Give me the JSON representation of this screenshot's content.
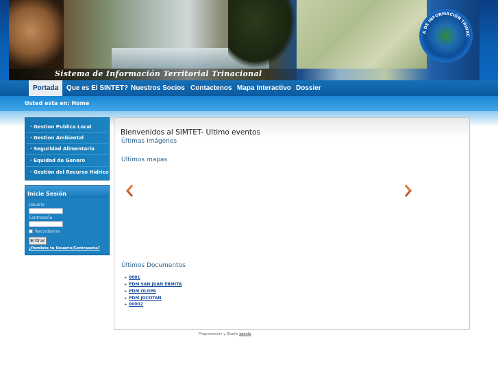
{
  "header": {
    "site_title": "Sistema de Información Territorial Trinacional",
    "logo_text": "SISTEMA DE INFORMACIÓN TRINACIONAL"
  },
  "nav": {
    "items": [
      "Portada",
      "Que es El SINTET?",
      "Nuestros Socios",
      "Contactenos",
      "Mapa Interactivo",
      "Dossier"
    ],
    "active": "Portada"
  },
  "breadcrumb": "Usted esta en: Home",
  "menu": {
    "items": [
      "Gestion Publica Local",
      "Gestion Ambiental",
      "Seguridad Alimentaria",
      "Equidad de Genero",
      "Gestión del Recurso Hídrico"
    ]
  },
  "login": {
    "title": "Inicie Sesión",
    "username_label": "Usuario",
    "password_label": "Contraseña",
    "remember_label": "Recordarme",
    "submit_label": "Entrar",
    "forgot_label": "¿Perdiste tu Usuario/Contraseña?"
  },
  "main": {
    "title": "Bienvenidos al SIMTET- Ultimo eventos",
    "images_heading": "Últimas Imágenes",
    "maps_heading": "Ultimos mapas",
    "docs_heading": "Últimos Documentos",
    "documents": [
      "0001",
      "PDM SAN JUAN ERMITA",
      "PDM OLOPA",
      "PDM JOCOTAN",
      "00002"
    ]
  },
  "footer": {
    "text": "Programacion y Diseño",
    "link": "joomla"
  },
  "colors": {
    "nav_bg": "#0b5aa0",
    "accent": "#1d80bf",
    "arrow": "#c0522a"
  }
}
